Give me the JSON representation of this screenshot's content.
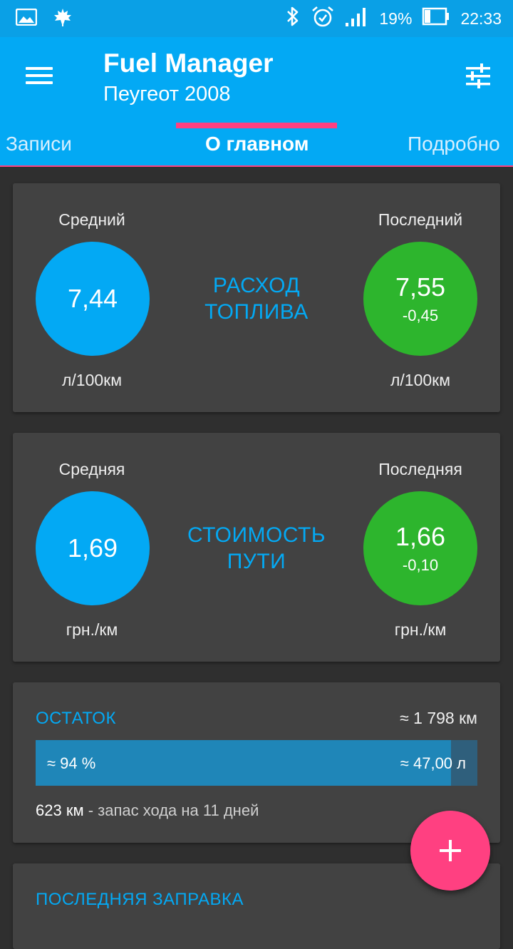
{
  "status_bar": {
    "icons": [
      "gallery-icon",
      "leaf-icon",
      "bluetooth-icon",
      "alarm-icon",
      "signal-icon",
      "battery-icon"
    ],
    "battery": "19%",
    "time": "22:33"
  },
  "app_bar": {
    "title": "Fuel Manager",
    "subtitle": "Пеугеот 2008",
    "menu_icon": "menu-icon",
    "tune_icon": "tune-icon"
  },
  "tabs": [
    {
      "label": "Записи"
    },
    {
      "label": "О главном"
    },
    {
      "label": "Подробно"
    }
  ],
  "active_tab": 1,
  "fuel_card": {
    "avg_label": "Средний",
    "avg_value": "7,44",
    "avg_unit": "л/100км",
    "title_line1": "РАСХОД",
    "title_line2": "ТОПЛИВА",
    "last_label": "Последний",
    "last_value": "7,55",
    "last_delta": "-0,45",
    "last_unit": "л/100км"
  },
  "cost_card": {
    "avg_label": "Средняя",
    "avg_value": "1,69",
    "avg_unit": "грн./км",
    "title_line1": "СТОИМОСТЬ",
    "title_line2": "ПУТИ",
    "last_label": "Последняя",
    "last_value": "1,66",
    "last_delta": "-0,10",
    "last_unit": "грн./км"
  },
  "remainder_card": {
    "title": "ОСТАТОК",
    "range": "≈ 1 798 км",
    "percent_text": "≈ 94 %",
    "fill_fraction": 0.94,
    "volume_text": "≈ 47,00 л",
    "reserve_km": "623 км",
    "reserve_text": " - запас хода на 11 дней"
  },
  "last_refuel_card": {
    "title": "ПОСЛЕДНЯЯ ЗАПРАВКА"
  },
  "colors": {
    "primary": "#03a9f4",
    "accent": "#ff4081",
    "green": "#2db52d",
    "card": "#424242",
    "background": "#2f2f2f"
  }
}
